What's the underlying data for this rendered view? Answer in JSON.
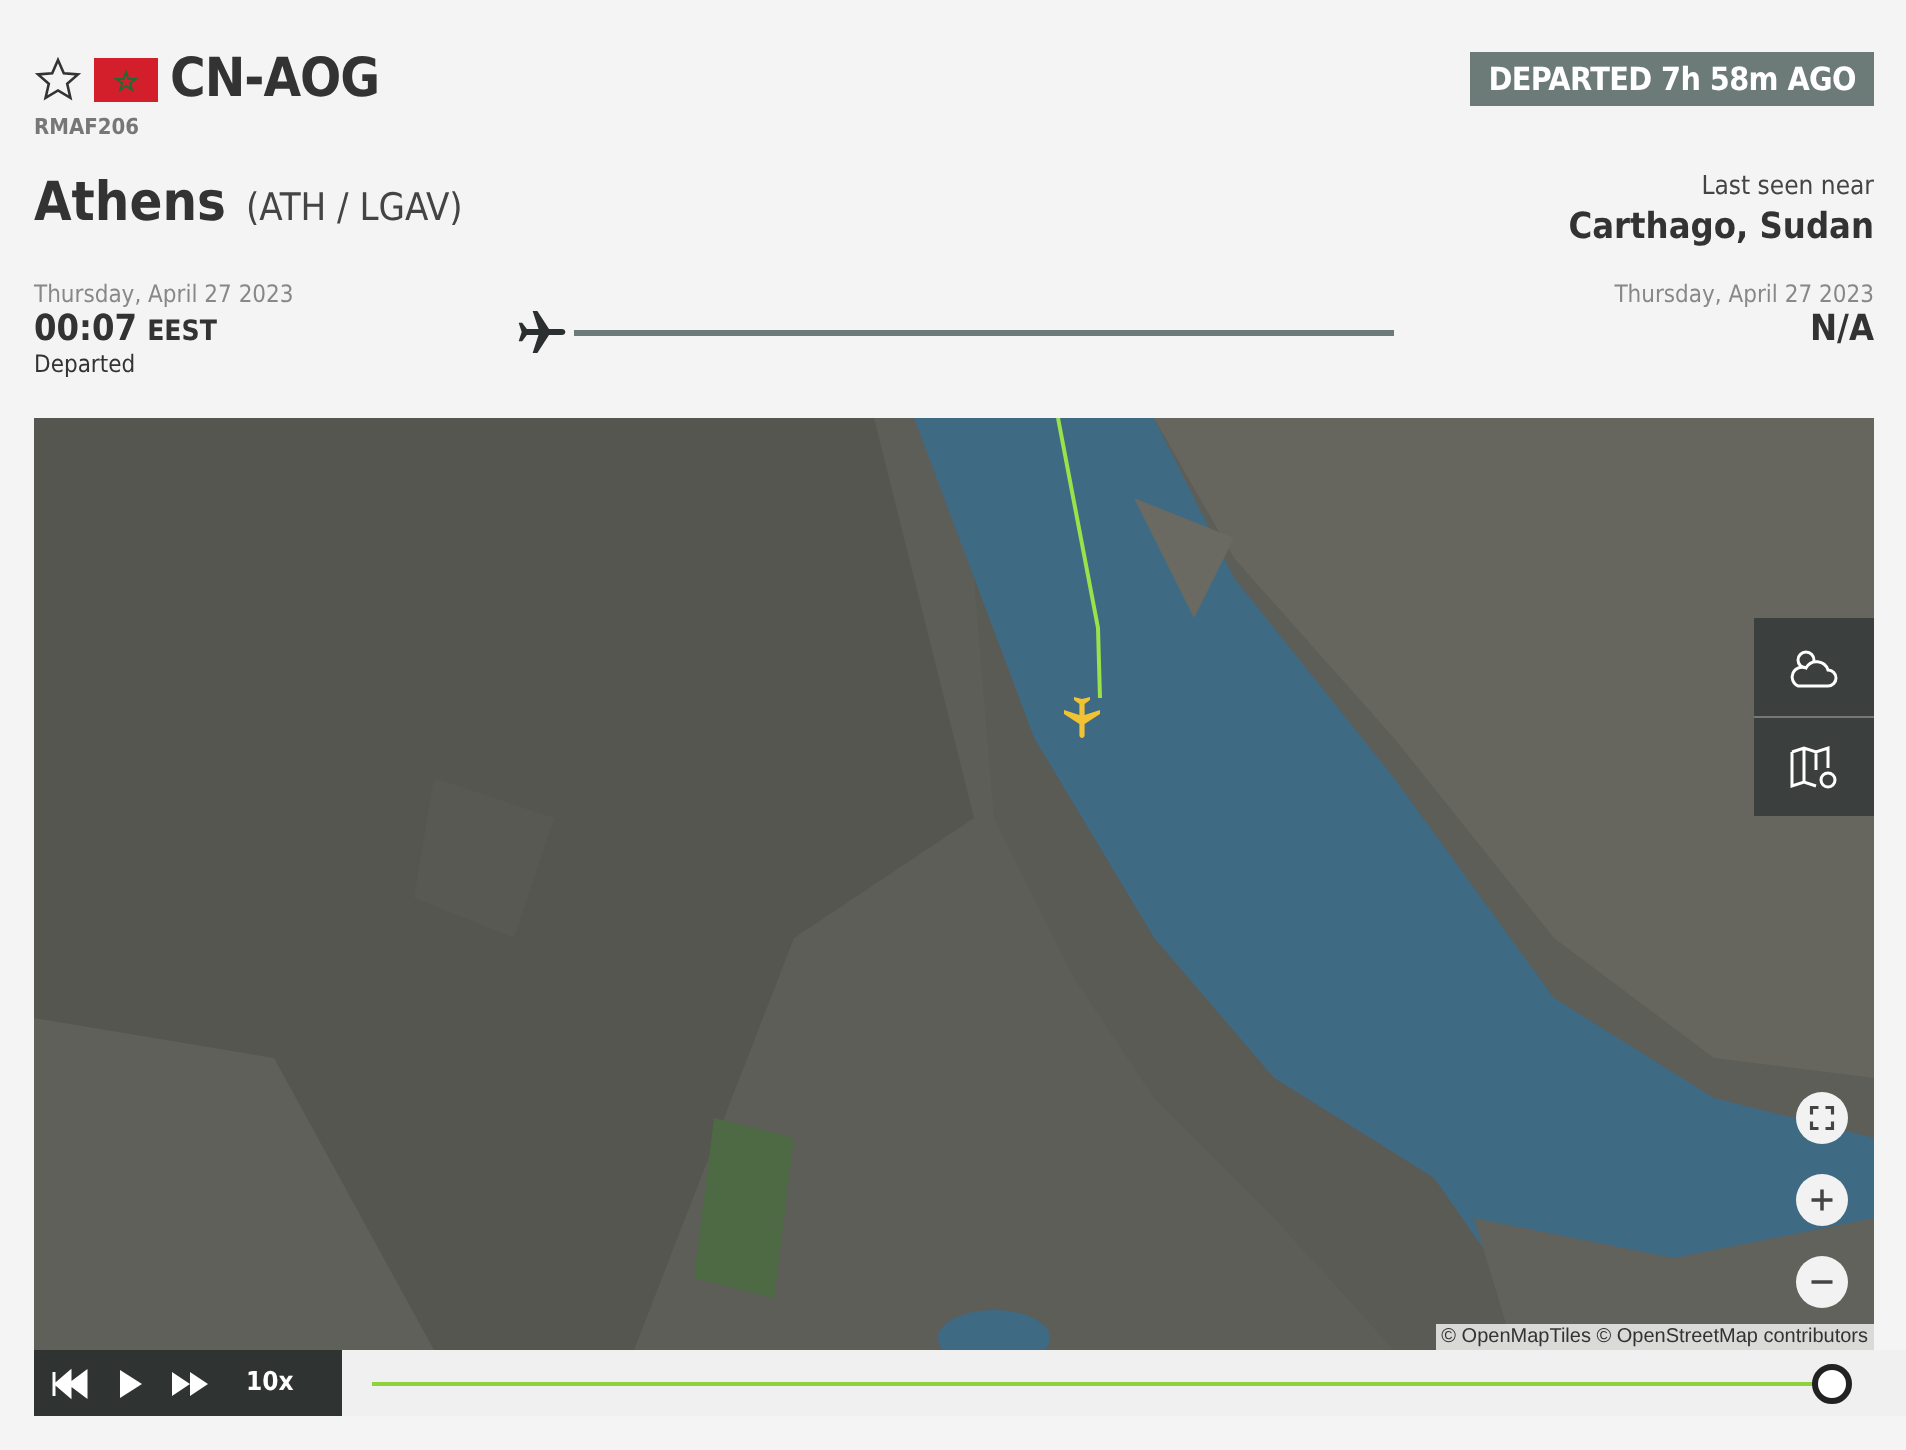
{
  "header": {
    "favorite": false,
    "registration": "CN-AOG",
    "callsign": "RMAF206",
    "status": "DEPARTED 7h 58m AGO"
  },
  "origin": {
    "city": "Athens",
    "codes": "(ATH / LGAV)",
    "date": "Thursday, April 27 2023",
    "time": "00:07",
    "zone": "EEST",
    "note": "Departed"
  },
  "destination": {
    "label": "Last seen near",
    "place": "Carthago, Sudan",
    "date": "Thursday, April 27 2023",
    "time": "N/A"
  },
  "map": {
    "attribution": "© OpenMapTiles © OpenStreetMap contributors"
  },
  "playback": {
    "speed": "10x",
    "level": 0.99
  }
}
